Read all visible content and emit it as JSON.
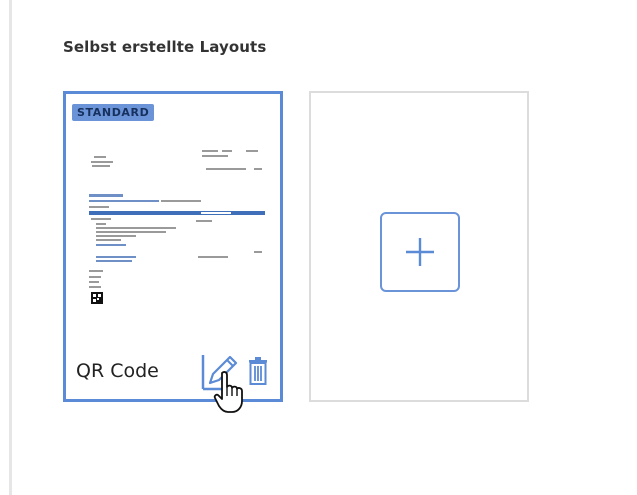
{
  "section": {
    "title": "Selbst erstellte Layouts"
  },
  "layouts": [
    {
      "badge": "STANDARD",
      "name": "QR Code",
      "edit_icon": "pencil-icon",
      "delete_icon": "trash-icon"
    }
  ],
  "add_card": {
    "icon": "plus-icon"
  },
  "colors": {
    "accent": "#5b8ad6",
    "badge_bg": "#6b93d8",
    "badge_text": "#17315f",
    "card_border_inactive": "#dcdcdc",
    "rule": "#e6e6e6"
  }
}
